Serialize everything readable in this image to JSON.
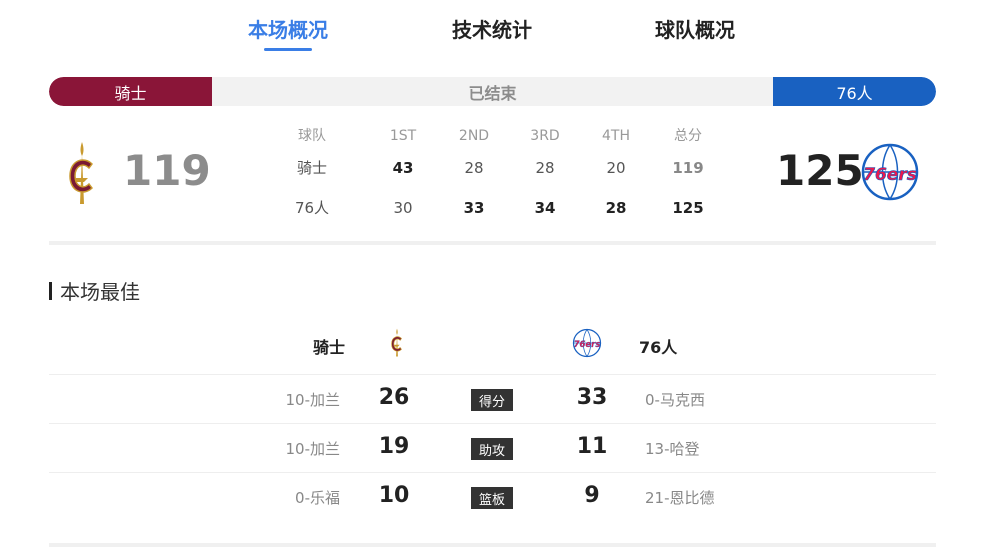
{
  "tabs": [
    {
      "label": "本场概况",
      "active": true
    },
    {
      "label": "技术统计",
      "active": false
    },
    {
      "label": "球队概况",
      "active": false
    }
  ],
  "status_bar": {
    "home_team": "骑士",
    "status": "已结束",
    "away_team": "76人",
    "home_color": "#8a1538",
    "away_color": "#1961c1"
  },
  "score": {
    "home": "119",
    "away": "125",
    "home_logo_icon": "cavaliers-logo-icon",
    "away_logo_icon": "76ers-logo-icon"
  },
  "quarter_table": {
    "headers": [
      "球队",
      "1ST",
      "2ND",
      "3RD",
      "4TH",
      "总分"
    ],
    "rows": [
      {
        "team": "骑士",
        "q": [
          "43",
          "28",
          "28",
          "20"
        ],
        "total": "119"
      },
      {
        "team": "76人",
        "q": [
          "30",
          "33",
          "34",
          "28"
        ],
        "total": "125"
      }
    ]
  },
  "best": {
    "title": "本场最佳",
    "home_team": "骑士",
    "away_team": "76人",
    "rows": [
      {
        "home_player": "10-加兰",
        "home_value": "26",
        "category": "得分",
        "away_value": "33",
        "away_player": "0-马克西"
      },
      {
        "home_player": "10-加兰",
        "home_value": "19",
        "category": "助攻",
        "away_value": "11",
        "away_player": "13-哈登"
      },
      {
        "home_player": "0-乐福",
        "home_value": "10",
        "category": "篮板",
        "away_value": "9",
        "away_player": "21-恩比德"
      }
    ]
  }
}
